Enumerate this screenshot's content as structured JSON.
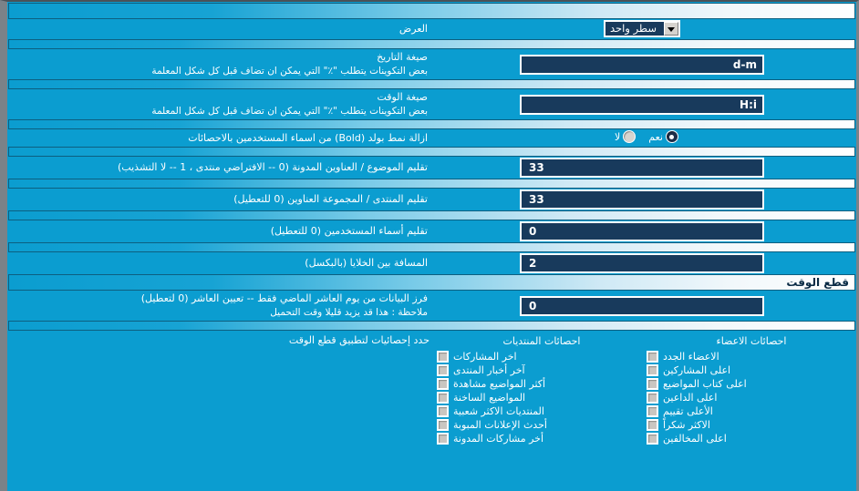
{
  "sections": {
    "display": {
      "title": "العرض"
    },
    "timecut": {
      "title": "قطع الوقت"
    }
  },
  "rows": {
    "display_mode": {
      "label": "العرض",
      "select_value": "سطر واحد"
    },
    "date_format": {
      "label": "صيغة التاريخ",
      "desc": "بعض التكوينات يتطلب \"٪\" التي يمكن ان تضاف قبل كل شكل المعلمة",
      "value": "d-m"
    },
    "time_format": {
      "label": "صيغة الوقت",
      "desc": "بعض التكوينات يتطلب \"٪\" التي يمكن ان تضاف قبل كل شكل المعلمة",
      "value": "H:i"
    },
    "remove_bold": {
      "label": "ازالة نمط بولد (Bold) من اسماء المستخدمين بالاحصائات",
      "yes_label": "نعم",
      "no_label": "لا",
      "selected": "yes"
    },
    "trim_thread_titles": {
      "label": "تقليم الموضوع / العناوين المدونة (0 -- الافتراضي منتدى ، 1 -- لا التشذيب)",
      "value": "33"
    },
    "trim_forum_titles": {
      "label": "تقليم المنتدى / المجموعة العناوين (0 للتعطيل)",
      "value": "33"
    },
    "trim_usernames": {
      "label": "تقليم أسماء المستخدمين (0 للتعطيل)",
      "value": "0"
    },
    "cell_spacing": {
      "label": "المسافة بين الخلايا (بالبكسل)",
      "value": "2"
    },
    "cutoff_days": {
      "label": "فرز البيانات من يوم العاشر الماضي فقط -- تعيين العاشر (0 لتعطيل)",
      "desc": "ملاحظة : هذا قد يزيد قليلا وقت التحميل",
      "value": "0"
    },
    "cutoff_stats": {
      "label": "حدد إحصائيات لتطبيق قطع الوقت"
    }
  },
  "checkbox_columns": [
    {
      "header": "احصائات الاعضاء",
      "items": [
        {
          "label": "الاعضاء الجدد",
          "checked": false
        },
        {
          "label": "اعلى المشاركين",
          "checked": false
        },
        {
          "label": "اعلى كتاب المواضيع",
          "checked": false
        },
        {
          "label": "اعلى الداعين",
          "checked": false
        },
        {
          "label": "الأعلى تقييم",
          "checked": false
        },
        {
          "label": "الاكثر شكراً",
          "checked": false
        },
        {
          "label": "اعلى المخالفين",
          "checked": false
        }
      ]
    },
    {
      "header": "احصائات المنتديات",
      "items": [
        {
          "label": "اخر المشاركات",
          "checked": false
        },
        {
          "label": "آخر أخبار المنتدى",
          "checked": false
        },
        {
          "label": "أكثر المواضيع مشاهدة",
          "checked": false
        },
        {
          "label": "المواضيع الساخنة",
          "checked": false
        },
        {
          "label": "المنتديات الاكثر شعبية",
          "checked": false
        },
        {
          "label": "أحدث الإعلانات المبوبة",
          "checked": false
        },
        {
          "label": "أخر مشاركات المدونة",
          "checked": false
        }
      ]
    }
  ],
  "colors": {
    "panel_bg": "#0b9dd0",
    "input_bg": "#183a5c",
    "frame_gray": "#7b8288",
    "section_title": "#0a2b45"
  }
}
